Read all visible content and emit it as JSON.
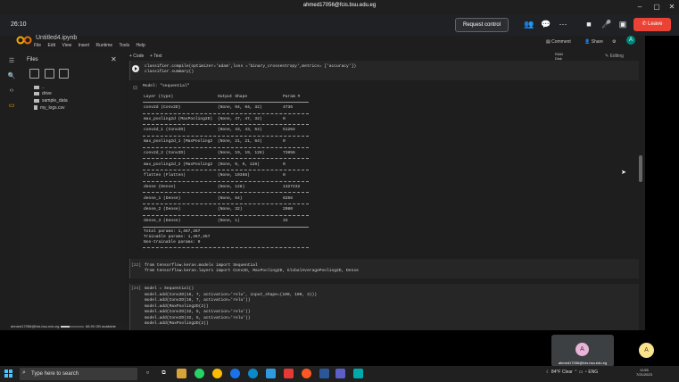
{
  "meet": {
    "account": "ahmed17056@fcis.bsu.edu.eg",
    "time": "26:10",
    "request_control": "Request control",
    "leave": "Leave",
    "participant1_initial": "A",
    "participant1_name": "ahmed17056@fcis.bsu.edu.eg",
    "participant2_initial": "A"
  },
  "colab": {
    "title": "Untitled4.ipynb",
    "menu": [
      "File",
      "Edit",
      "View",
      "Insert",
      "Runtime",
      "Tools",
      "Help"
    ],
    "comment": "Comment",
    "share": "Share",
    "avatar": "A",
    "add_code": "+ Code",
    "add_text": "+ Text",
    "ram": "RAM",
    "disk_label": "Disk",
    "editing": "Editing",
    "disk_user": "ahmed17056@fcis.bsu.edu.eg",
    "disk_available": "68.90 GB available"
  },
  "files": {
    "title": "Files",
    "items": [
      "..",
      "drive",
      "sample_data",
      "my_logs.csv"
    ]
  },
  "cell1": {
    "line1": "classifier.compile(optimizer='adam',loss ='binary_crossentropy',metrics= ['accuracy'])",
    "line2": "classifier.summary()"
  },
  "summary": {
    "title": "Model: \"sequential\"",
    "headers": [
      "Layer (type)",
      "Output Shape",
      "Param #"
    ],
    "rows": [
      [
        "conv2d (Conv2D)",
        "(None, 94, 94, 32)",
        "4736"
      ],
      [
        "max_pooling2d (MaxPooling2D)",
        "(None, 47, 47, 32)",
        "0"
      ],
      [
        "conv2d_1 (Conv2D)",
        "(None, 43, 43, 64)",
        "51264"
      ],
      [
        "max_pooling2d_1 (MaxPooling2",
        "(None, 21, 21, 64)",
        "0"
      ],
      [
        "conv2d_2 (Conv2D)",
        "(None, 19, 19, 128)",
        "73856"
      ],
      [
        "max_pooling2d_2 (MaxPooling2",
        "(None, 9, 9, 128)",
        "0"
      ],
      [
        "flatten (Flatten)",
        "(None, 10368)",
        "0"
      ],
      [
        "dense (Dense)",
        "(None, 128)",
        "1327232"
      ],
      [
        "dense_1 (Dense)",
        "(None, 64)",
        "8256"
      ],
      [
        "dense_2 (Dense)",
        "(None, 32)",
        "2080"
      ],
      [
        "dense_3 (Dense)",
        "(None, 1)",
        "33"
      ]
    ],
    "total": "Total params: 1,467,457",
    "trainable": "Trainable params: 1,467,457",
    "non_trainable": "Non-trainable params: 0"
  },
  "cell22": {
    "exec": "[22]",
    "line1": "from tensorflow.keras.models import Sequential",
    "line2": "from tensorflow.keras.layers import Conv2D, MaxPooling2D, GlobalAveragePooling2D, Dense"
  },
  "cell24": {
    "exec": "[24]",
    "lines": [
      "model = Sequential()",
      "model.add(Conv2D(16, 7, activation='relu', input_shape=(100, 100, 3)))",
      "model.add(Conv2D(16, 7, activation='relu'))",
      "model.add(MaxPooling2D(2))",
      "model.add(Conv2D(32, 5, activation='relu'))",
      "model.add(Conv2D(32, 5, activation='relu'))",
      "model.add(MaxPooling2D(2))"
    ]
  },
  "taskbar": {
    "search_placeholder": "Type here to search",
    "weather": "84°F Clear",
    "lang": "ENG",
    "time": "11:55",
    "date": "7/21/2023"
  }
}
